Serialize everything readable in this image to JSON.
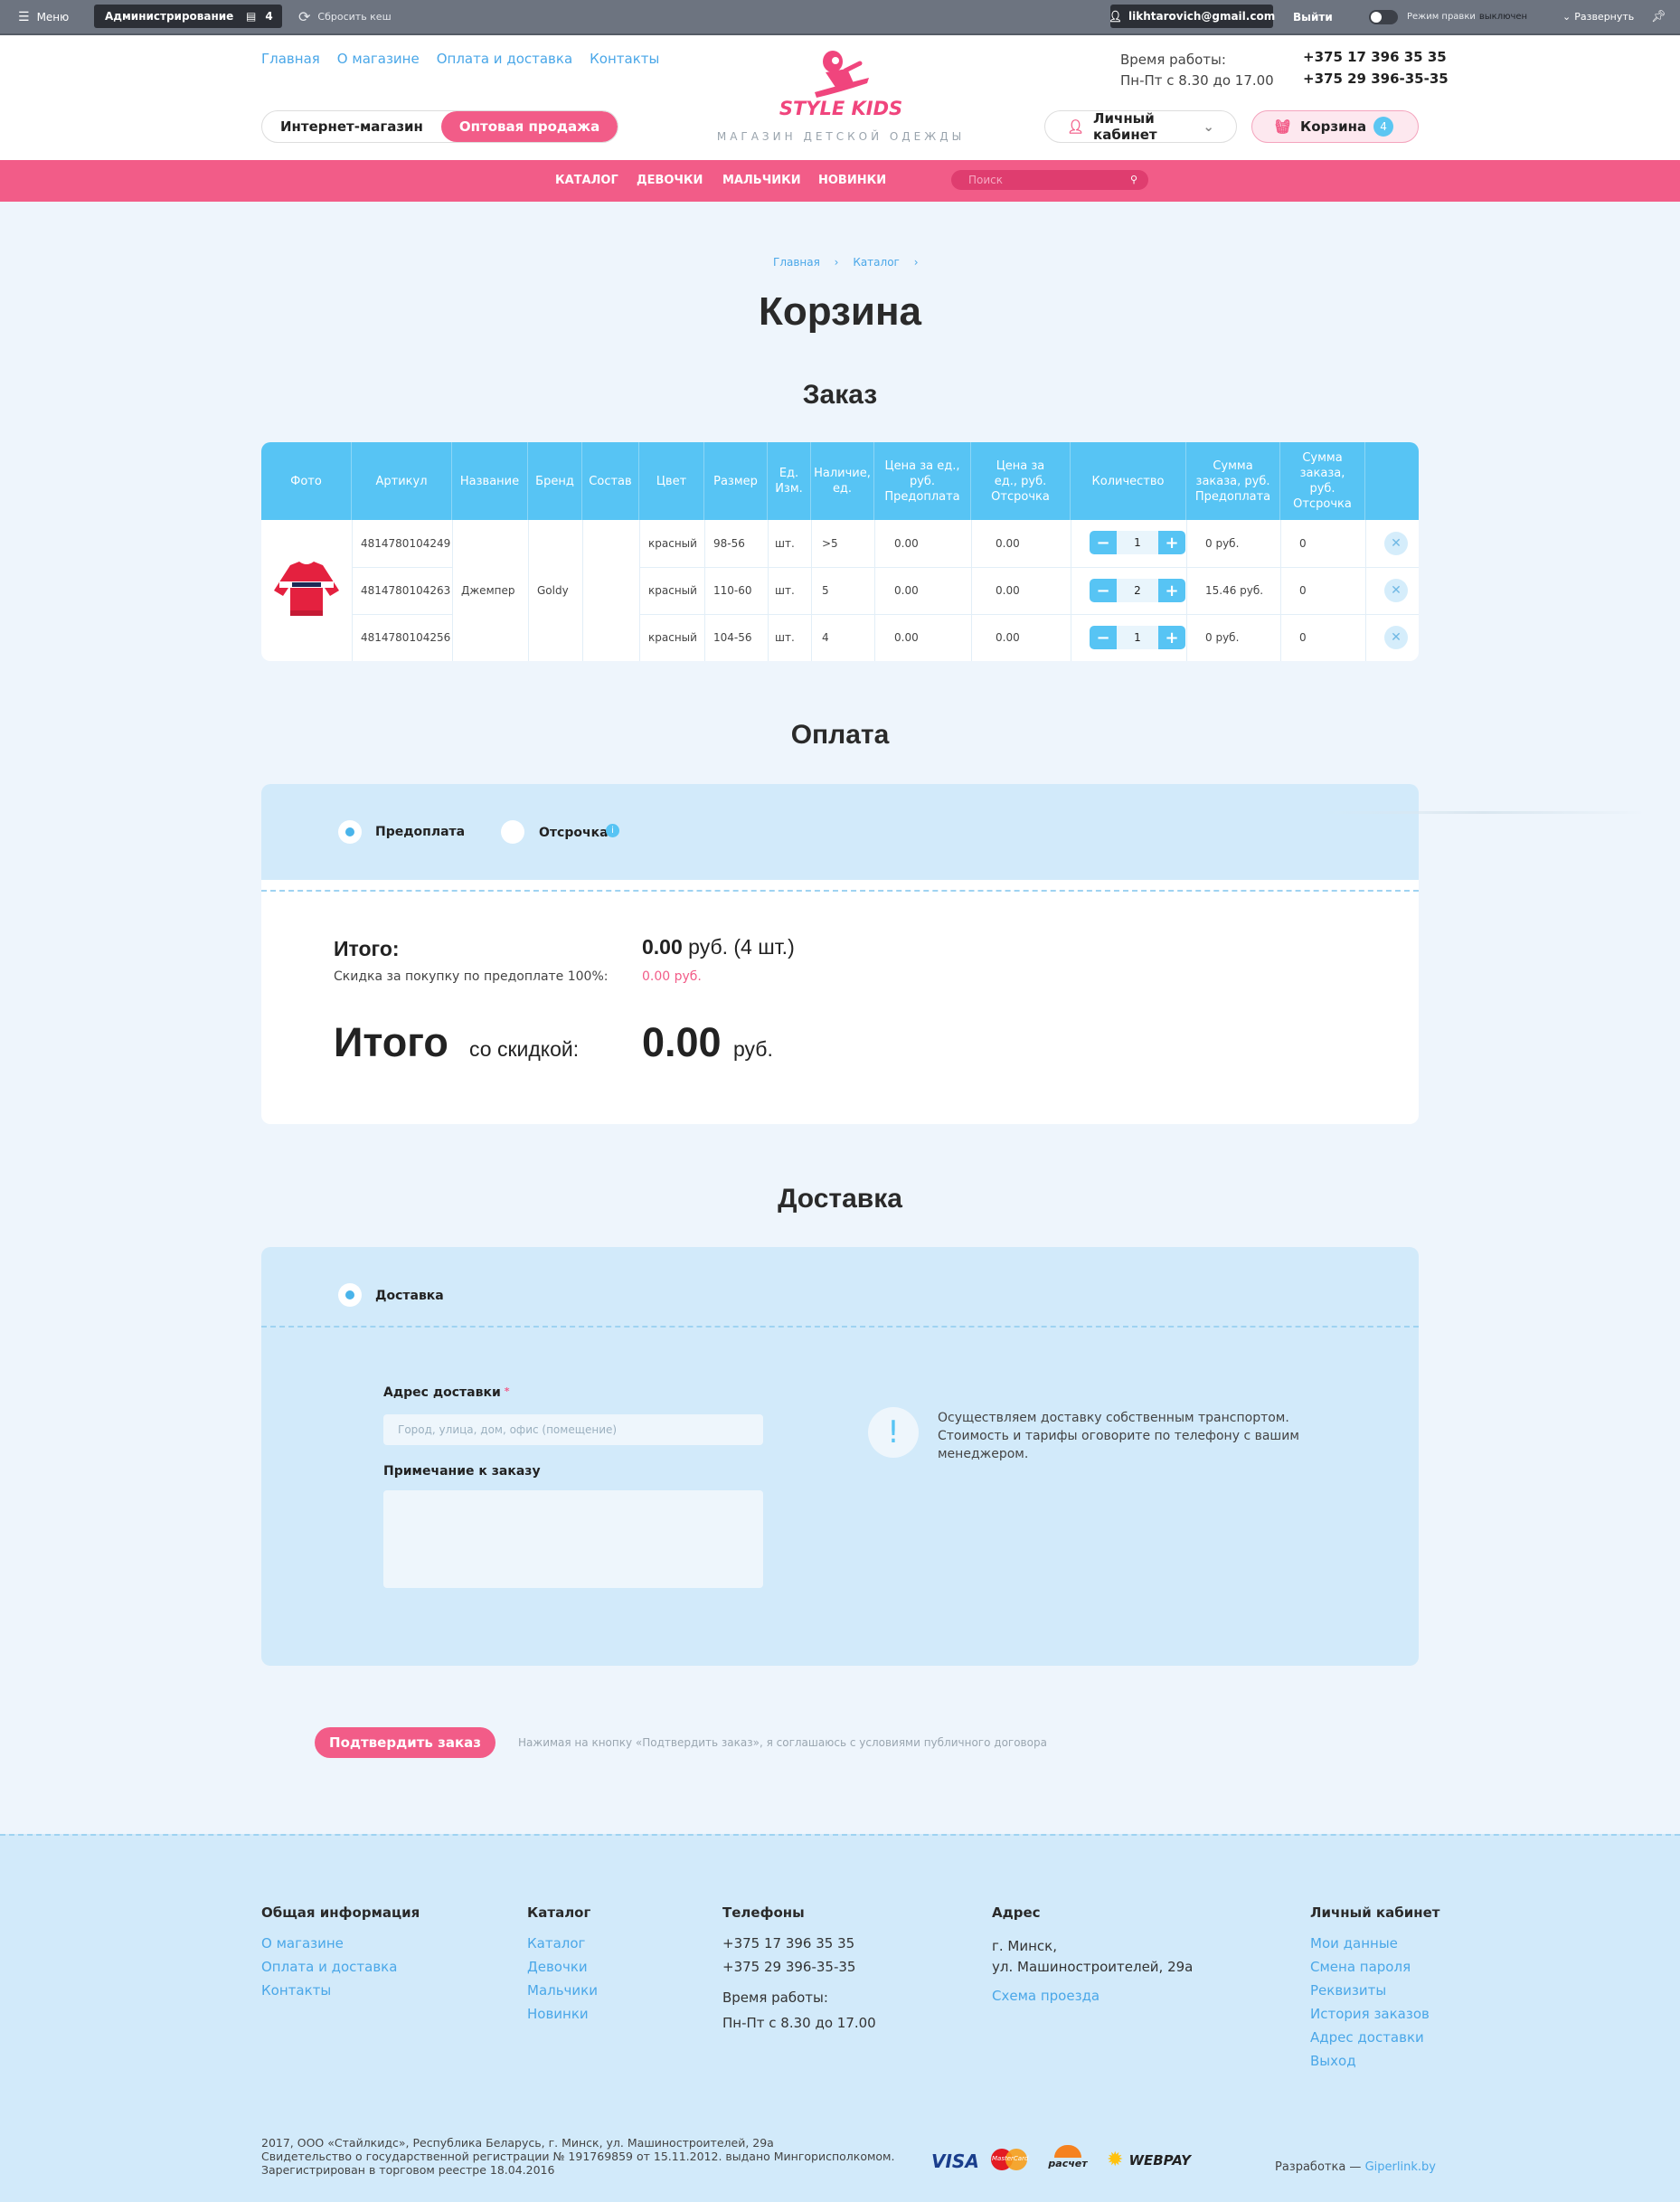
{
  "adminbar": {
    "menu": "Меню",
    "admin": "Администрирование",
    "count": "4",
    "reset_cache": "Сбросить кеш",
    "user": "likhtarovich@gmail.com",
    "logout": "Выйти",
    "edit_mode": "Режим правки",
    "edit_state": "выключен",
    "expand": "Развернуть"
  },
  "header": {
    "links": [
      "Главная",
      "О магазине",
      "Оплата и доставка",
      "Контакты"
    ],
    "logo": "STYLE KIDS",
    "logo_sub": "МАГАЗИН ДЕТСКОЙ ОДЕЖДЫ",
    "hours_label": "Время работы:",
    "hours": "Пн-Пт с 8.30 до 17.00",
    "phone1": "+375 17 396 35 35",
    "phone2": "+375 29 396-35-35",
    "seg_retail": "Интернет-магазин",
    "seg_wholesale": "Оптовая продажа",
    "account": "Личный кабинет",
    "cart": "Корзина",
    "cart_count": "4"
  },
  "nav": {
    "items": [
      "КАТАЛОГ",
      "ДЕВОЧКИ",
      "МАЛЬЧИКИ",
      "НОВИНКИ"
    ],
    "search_placeholder": "Поиск"
  },
  "breadcrumb": [
    "Главная",
    "Каталог"
  ],
  "page_title": "Корзина",
  "order": {
    "title": "Заказ",
    "columns": [
      "Фото",
      "Артикул",
      "Название",
      "Бренд",
      "Состав",
      "Цвет",
      "Размер",
      "Ед. Изм.",
      "Наличие, ед.",
      "Цена за ед., руб. Предоплата",
      "Цена за ед., руб. Отсрочка",
      "Количество",
      "Сумма заказа, руб. Предоплата",
      "Сумма заказа, руб. Отсрочка"
    ],
    "name": "Джемпер",
    "brand": "Goldy",
    "rows": [
      {
        "sku": "4814780104249",
        "color": "красный",
        "size": "98-56",
        "unit": "шт.",
        "stock": ">5",
        "price_pre": "0.00",
        "price_def": "0.00",
        "qty": "1",
        "sum_pre": "0 руб.",
        "sum_def": "0"
      },
      {
        "sku": "4814780104263",
        "color": "красный",
        "size": "110-60",
        "unit": "шт.",
        "stock": "5",
        "price_pre": "0.00",
        "price_def": "0.00",
        "qty": "2",
        "sum_pre": "15.46 руб.",
        "sum_def": "0"
      },
      {
        "sku": "4814780104256",
        "color": "красный",
        "size": "104-56",
        "unit": "шт.",
        "stock": "4",
        "price_pre": "0.00",
        "price_def": "0.00",
        "qty": "1",
        "sum_pre": "0 руб.",
        "sum_def": "0"
      }
    ]
  },
  "payment": {
    "title": "Оплата",
    "option_pre": "Предоплата",
    "option_def": "Отсрочка",
    "total_label": "Итого:",
    "total_value": "0.00",
    "total_suffix": "руб. (4 шт.)",
    "discount_label": "Скидка за покупку по предоплате 100%:",
    "discount_value": "0.00 руб.",
    "final_label": "Итого",
    "final_sub": "со скидкой:",
    "final_value": "0.00",
    "final_currency": "руб."
  },
  "delivery": {
    "title": "Доставка",
    "option": "Доставка",
    "address_label": "Адрес доставки",
    "address_placeholder": "Город, улица, дом, офис (помещение)",
    "note_label": "Примечание к заказу",
    "info": "Осуществляем доставку собственным транспортом. Стоимость и тарифы оговорите по телефону с вашим менеджером."
  },
  "confirm": {
    "button": "Подтвердить заказ",
    "agreement": "Нажимая на кнопку «Подтвердить заказ», я соглашаюсь с условиями публичного договора"
  },
  "footer": {
    "info_title": "Общая информация",
    "info_links": [
      "О магазине",
      "Оплата и доставка",
      "Контакты"
    ],
    "catalog_title": "Каталог",
    "catalog_links": [
      "Каталог",
      "Девочки",
      "Мальчики",
      "Новинки"
    ],
    "phones_title": "Телефоны",
    "phone1": "+375 17 396 35 35",
    "phone2": "+375 29 396-35-35",
    "hours_label": "Время работы:",
    "hours": "Пн-Пт с 8.30 до 17.00",
    "address_title": "Адрес",
    "address1": "г. Минск,",
    "address2": "ул. Машиностроителей, 29а",
    "map_link": "Схема проезда",
    "account_title": "Личный кабинет",
    "account_links": [
      "Мои данные",
      "Смена пароля",
      "Реквизиты",
      "История заказов",
      "Адрес доставки",
      "Выход"
    ],
    "legal1": "2017, ООО «Стайлкидс», Республика Беларусь, г. Минск, ул. Машиностроителей, 29а",
    "legal2": "Свидетельство о государственной регистрации № 191769859 от 15.11.2012. выдано Мингорисполкомом.",
    "legal3": "Зарегистрирован в торговом реестре 18.04.2016",
    "pay_visa": "VISA",
    "pay_mc": "MasterCard",
    "pay_raschet": "расчет",
    "pay_webpay": "WEBPAY",
    "dev_label": "Разработка —",
    "dev_link": "Giperlink.by"
  },
  "colors": {
    "accent": "#f25c88",
    "blue": "#57c4f4",
    "light_blue": "#d2eafa"
  }
}
